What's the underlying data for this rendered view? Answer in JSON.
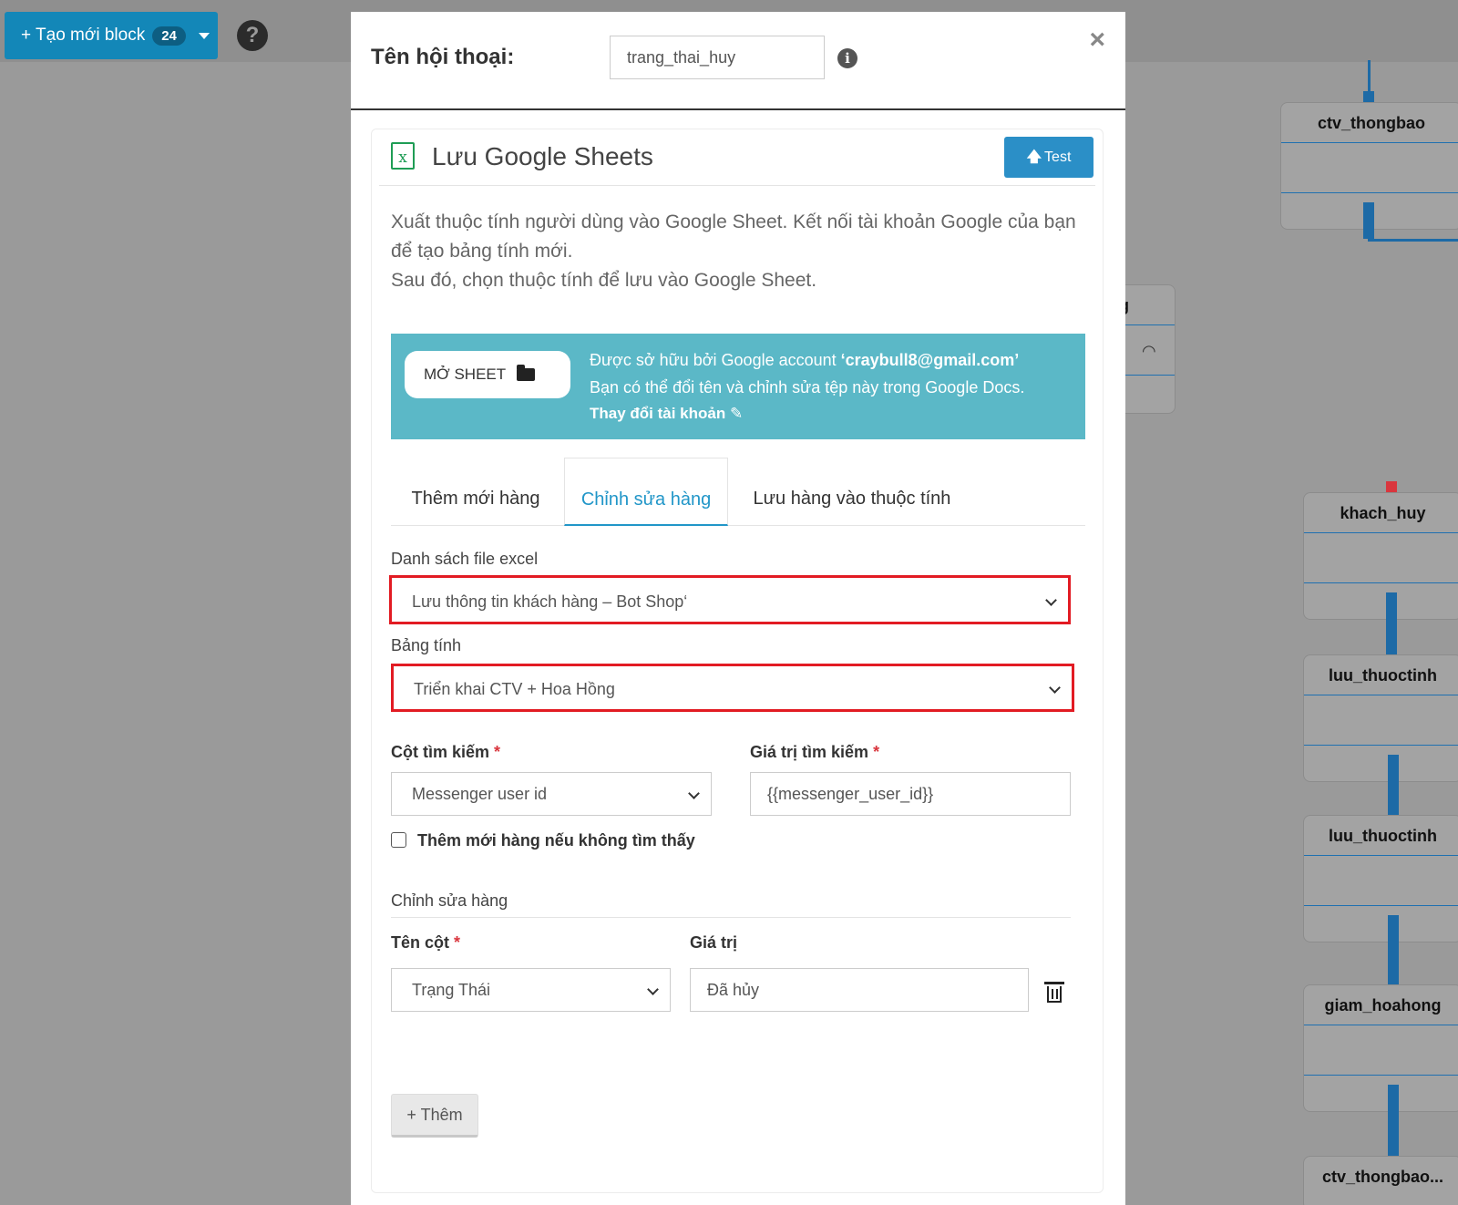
{
  "toolbar": {
    "create_label": "+ Tạo mới block",
    "create_count": "24",
    "help_symbol": "?"
  },
  "canvas": {
    "nodes": [
      {
        "name": "ctv_thongbao"
      },
      {
        "name": "g"
      },
      {
        "name": "khach_huy"
      },
      {
        "name": "luu_thuoctinh"
      },
      {
        "name": "luu_thuoctinh"
      },
      {
        "name": "giam_hoahong"
      },
      {
        "name": "ctv_thongbao..."
      }
    ]
  },
  "modal": {
    "dialog_label": "Tên hội thoại:",
    "dialog_name_value": "trang_thai_huy",
    "info_symbol": "i",
    "close_symbol": "×",
    "panel": {
      "icon_letter": "x",
      "title": "Lưu Google Sheets",
      "test_arrow": "🡅",
      "test_label": "Test",
      "description": [
        "Xuất thuộc tính người dùng vào Google Sheet. Kết nối tài khoản Google của bạn",
        "để tạo bảng tính mới.",
        "Sau đó, chọn thuộc tính để lưu vào Google Sheet."
      ],
      "banner": {
        "open_sheet_label": "MỞ SHEET",
        "owned_by_prefix": "Được sở hữu bởi Google account ",
        "owned_by_account": "‘craybull8@gmail.com’",
        "rename_text": "Bạn có thể đổi tên và chỉnh sửa tệp này trong Google Docs.",
        "change_account_label": "Thay đổi tài khoản",
        "pencil_symbol": "✎"
      },
      "tabs": [
        {
          "label": "Thêm mới hàng",
          "active": false
        },
        {
          "label": "Chỉnh sửa hàng",
          "active": true
        },
        {
          "label": "Lưu hàng vào thuộc tính",
          "active": false
        }
      ],
      "file_list_label": "Danh sách file excel",
      "file_list_value": "Lưu thông tin khách hàng – Bot Shop‘",
      "sheet_label": "Bảng tính",
      "sheet_value": "Triển khai CTV + Hoa Hồng",
      "search_column_label": "Cột tìm kiếm",
      "search_column_value": "Messenger user id",
      "search_value_label": "Giá trị tìm kiếm",
      "search_value_value": "{{messenger_user_id}}",
      "required_mark": "*",
      "add_if_not_found_label": "Thêm mới hàng nếu không tìm thấy",
      "add_if_not_found_checked": false,
      "edit_row_section_label": "Chỉnh sửa hàng",
      "column_name_label": "Tên cột",
      "value_label": "Giá trị",
      "rows": [
        {
          "column": "Trạng Thái",
          "value": "Đã hủy"
        }
      ],
      "add_button_label": "+ Thêm"
    }
  },
  "colors": {
    "accent": "#2196c8",
    "banner": "#5bb8c7",
    "highlight": "#e21b23",
    "connector": "#1d6aa6"
  }
}
